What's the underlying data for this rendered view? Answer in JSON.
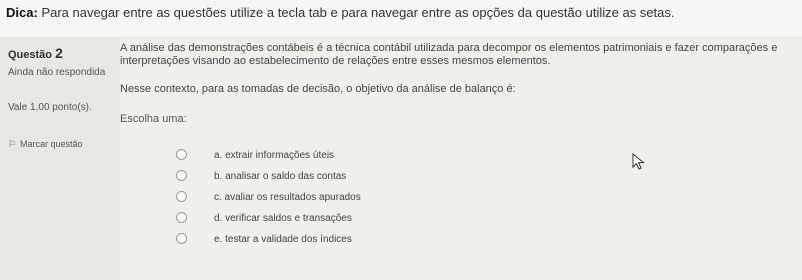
{
  "tip": {
    "label": "Dica:",
    "text": "Para navegar entre as questões utilize a tecla tab e para navegar entre as opções da questão utilize as setas."
  },
  "question": {
    "label": "Questão",
    "number": "2",
    "status": "Ainda não respondida",
    "score": "Vale 1,00 ponto(s).",
    "flag_label": "Marcar questão",
    "text": "A análise das demonstrações contábeis é a técnica contábil utilizada para decompor os elementos patrimoniais e fazer comparações e interpretações visando ao estabelecimento de relações entre esses mesmos elementos.",
    "context": "Nesse contexto, para as tomadas de decisão, o objetivo da análise de balanço é:",
    "choose_label": "Escolha uma:",
    "options": [
      {
        "label": "a. extrair informações úteis"
      },
      {
        "label": "b. analisar o saldo das contas"
      },
      {
        "label": "c. avaliar os resultados apurados"
      },
      {
        "label": "d. verificar saldos e transações"
      },
      {
        "label": "e. testar a validade dos índices"
      }
    ]
  }
}
